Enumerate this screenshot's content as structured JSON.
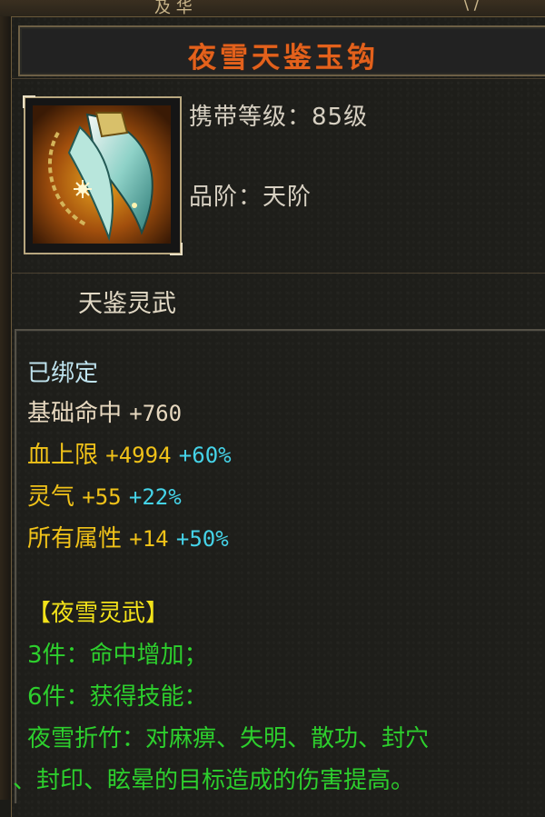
{
  "top_strip": {
    "left_text": "及 华",
    "right_text": "\\ /"
  },
  "item": {
    "name": "夜雪天鉴玉钩",
    "level_requirement": "携带等级：85级",
    "grade": "品阶：天阶",
    "subtitle": "天鉴灵武",
    "icon": "jade-hook-weapon-icon"
  },
  "stats": {
    "bound": "已绑定",
    "base_hit": {
      "label": "基础命中",
      "value": "+760"
    },
    "hp_max": {
      "label": "血上限",
      "value": "+4994",
      "percent": "+60%"
    },
    "spirit": {
      "label": "灵气",
      "value": "+55",
      "percent": "+22%"
    },
    "all_attr": {
      "label": "所有属性",
      "value": "+14",
      "percent": "+50%"
    }
  },
  "set": {
    "name": "【夜雪灵武】",
    "bonus3": "3件：命中增加；",
    "bonus6": "6件：获得技能：",
    "skill_line1": "夜雪折竹：对麻痹、失明、散功、封穴",
    "skill_line2": "、封印、眩晕的目标造成的伤害提高。"
  },
  "colors": {
    "title": "#e3611c",
    "gold": "#f0c219",
    "cyan": "#45d3e8",
    "green": "#2dcf2d",
    "set_yellow": "#f2e21a",
    "bound": "#bfe3ee"
  }
}
